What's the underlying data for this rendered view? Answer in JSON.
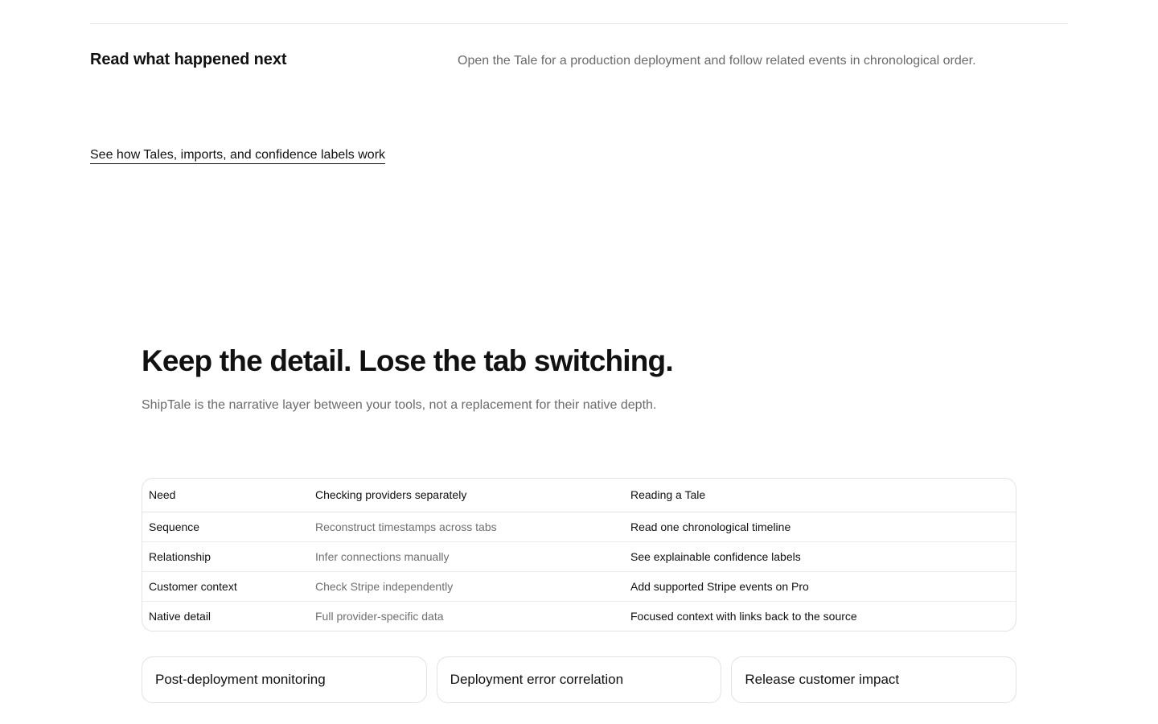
{
  "step": {
    "title": "Read what happened next",
    "description": "Open the Tale for a production deployment and follow related events in chronological order."
  },
  "explain_link": "See how Tales, imports, and confidence labels work",
  "comparison": {
    "title": "Keep the detail. Lose the tab switching.",
    "subtitle": "ShipTale is the narrative layer between your tools, not a replacement for their native depth.",
    "headers": [
      "Need",
      "Checking providers separately",
      "Reading a Tale"
    ],
    "rows": [
      [
        "Sequence",
        "Reconstruct timestamps across tabs",
        "Read one chronological timeline"
      ],
      [
        "Relationship",
        "Infer connections manually",
        "See explainable confidence labels"
      ],
      [
        "Customer context",
        "Check Stripe independently",
        "Add supported Stripe events on Pro"
      ],
      [
        "Native detail",
        "Full provider-specific data",
        "Focused context with links back to the source"
      ]
    ]
  },
  "cards": [
    "Post-deployment monitoring",
    "Deployment error correlation",
    "Release customer impact"
  ]
}
